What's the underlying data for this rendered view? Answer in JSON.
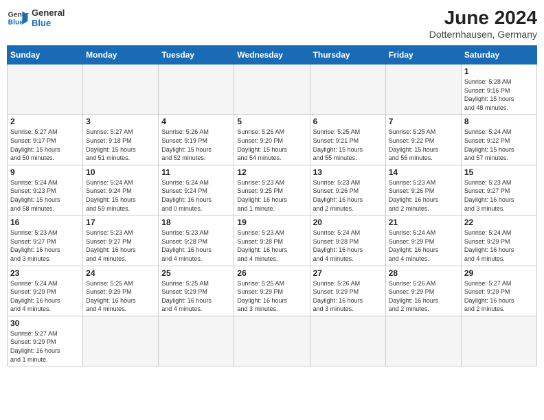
{
  "header": {
    "logo_general": "General",
    "logo_blue": "Blue",
    "month_year": "June 2024",
    "location": "Dotternhausen, Germany"
  },
  "weekdays": [
    "Sunday",
    "Monday",
    "Tuesday",
    "Wednesday",
    "Thursday",
    "Friday",
    "Saturday"
  ],
  "weeks": [
    [
      {
        "day": "",
        "info": ""
      },
      {
        "day": "",
        "info": ""
      },
      {
        "day": "",
        "info": ""
      },
      {
        "day": "",
        "info": ""
      },
      {
        "day": "",
        "info": ""
      },
      {
        "day": "",
        "info": ""
      },
      {
        "day": "1",
        "info": "Sunrise: 5:28 AM\nSunset: 9:16 PM\nDaylight: 15 hours\nand 48 minutes."
      }
    ],
    [
      {
        "day": "2",
        "info": "Sunrise: 5:27 AM\nSunset: 9:17 PM\nDaylight: 15 hours\nand 50 minutes."
      },
      {
        "day": "3",
        "info": "Sunrise: 5:27 AM\nSunset: 9:18 PM\nDaylight: 15 hours\nand 51 minutes."
      },
      {
        "day": "4",
        "info": "Sunrise: 5:26 AM\nSunset: 9:19 PM\nDaylight: 15 hours\nand 52 minutes."
      },
      {
        "day": "5",
        "info": "Sunrise: 5:26 AM\nSunset: 9:20 PM\nDaylight: 15 hours\nand 54 minutes."
      },
      {
        "day": "6",
        "info": "Sunrise: 5:25 AM\nSunset: 9:21 PM\nDaylight: 15 hours\nand 55 minutes."
      },
      {
        "day": "7",
        "info": "Sunrise: 5:25 AM\nSunset: 9:22 PM\nDaylight: 15 hours\nand 56 minutes."
      },
      {
        "day": "8",
        "info": "Sunrise: 5:24 AM\nSunset: 9:22 PM\nDaylight: 15 hours\nand 57 minutes."
      }
    ],
    [
      {
        "day": "9",
        "info": "Sunrise: 5:24 AM\nSunset: 9:23 PM\nDaylight: 15 hours\nand 58 minutes."
      },
      {
        "day": "10",
        "info": "Sunrise: 5:24 AM\nSunset: 9:24 PM\nDaylight: 15 hours\nand 59 minutes."
      },
      {
        "day": "11",
        "info": "Sunrise: 5:24 AM\nSunset: 9:24 PM\nDaylight: 16 hours\nand 0 minutes."
      },
      {
        "day": "12",
        "info": "Sunrise: 5:23 AM\nSunset: 9:25 PM\nDaylight: 16 hours\nand 1 minute."
      },
      {
        "day": "13",
        "info": "Sunrise: 5:23 AM\nSunset: 9:26 PM\nDaylight: 16 hours\nand 2 minutes."
      },
      {
        "day": "14",
        "info": "Sunrise: 5:23 AM\nSunset: 9:26 PM\nDaylight: 16 hours\nand 2 minutes."
      },
      {
        "day": "15",
        "info": "Sunrise: 5:23 AM\nSunset: 9:27 PM\nDaylight: 16 hours\nand 3 minutes."
      }
    ],
    [
      {
        "day": "16",
        "info": "Sunrise: 5:23 AM\nSunset: 9:27 PM\nDaylight: 16 hours\nand 3 minutes."
      },
      {
        "day": "17",
        "info": "Sunrise: 5:23 AM\nSunset: 9:27 PM\nDaylight: 16 hours\nand 4 minutes."
      },
      {
        "day": "18",
        "info": "Sunrise: 5:23 AM\nSunset: 9:28 PM\nDaylight: 16 hours\nand 4 minutes."
      },
      {
        "day": "19",
        "info": "Sunrise: 5:23 AM\nSunset: 9:28 PM\nDaylight: 16 hours\nand 4 minutes."
      },
      {
        "day": "20",
        "info": "Sunrise: 5:24 AM\nSunset: 9:28 PM\nDaylight: 16 hours\nand 4 minutes."
      },
      {
        "day": "21",
        "info": "Sunrise: 5:24 AM\nSunset: 9:29 PM\nDaylight: 16 hours\nand 4 minutes."
      },
      {
        "day": "22",
        "info": "Sunrise: 5:24 AM\nSunset: 9:29 PM\nDaylight: 16 hours\nand 4 minutes."
      }
    ],
    [
      {
        "day": "23",
        "info": "Sunrise: 5:24 AM\nSunset: 9:29 PM\nDaylight: 16 hours\nand 4 minutes."
      },
      {
        "day": "24",
        "info": "Sunrise: 5:25 AM\nSunset: 9:29 PM\nDaylight: 16 hours\nand 4 minutes."
      },
      {
        "day": "25",
        "info": "Sunrise: 5:25 AM\nSunset: 9:29 PM\nDaylight: 16 hours\nand 4 minutes."
      },
      {
        "day": "26",
        "info": "Sunrise: 5:25 AM\nSunset: 9:29 PM\nDaylight: 16 hours\nand 3 minutes."
      },
      {
        "day": "27",
        "info": "Sunrise: 5:26 AM\nSunset: 9:29 PM\nDaylight: 16 hours\nand 3 minutes."
      },
      {
        "day": "28",
        "info": "Sunrise: 5:26 AM\nSunset: 9:29 PM\nDaylight: 16 hours\nand 2 minutes."
      },
      {
        "day": "29",
        "info": "Sunrise: 5:27 AM\nSunset: 9:29 PM\nDaylight: 16 hours\nand 2 minutes."
      }
    ],
    [
      {
        "day": "30",
        "info": "Sunrise: 5:27 AM\nSunset: 9:29 PM\nDaylight: 16 hours\nand 1 minute."
      },
      {
        "day": "",
        "info": ""
      },
      {
        "day": "",
        "info": ""
      },
      {
        "day": "",
        "info": ""
      },
      {
        "day": "",
        "info": ""
      },
      {
        "day": "",
        "info": ""
      },
      {
        "day": "",
        "info": ""
      }
    ]
  ]
}
